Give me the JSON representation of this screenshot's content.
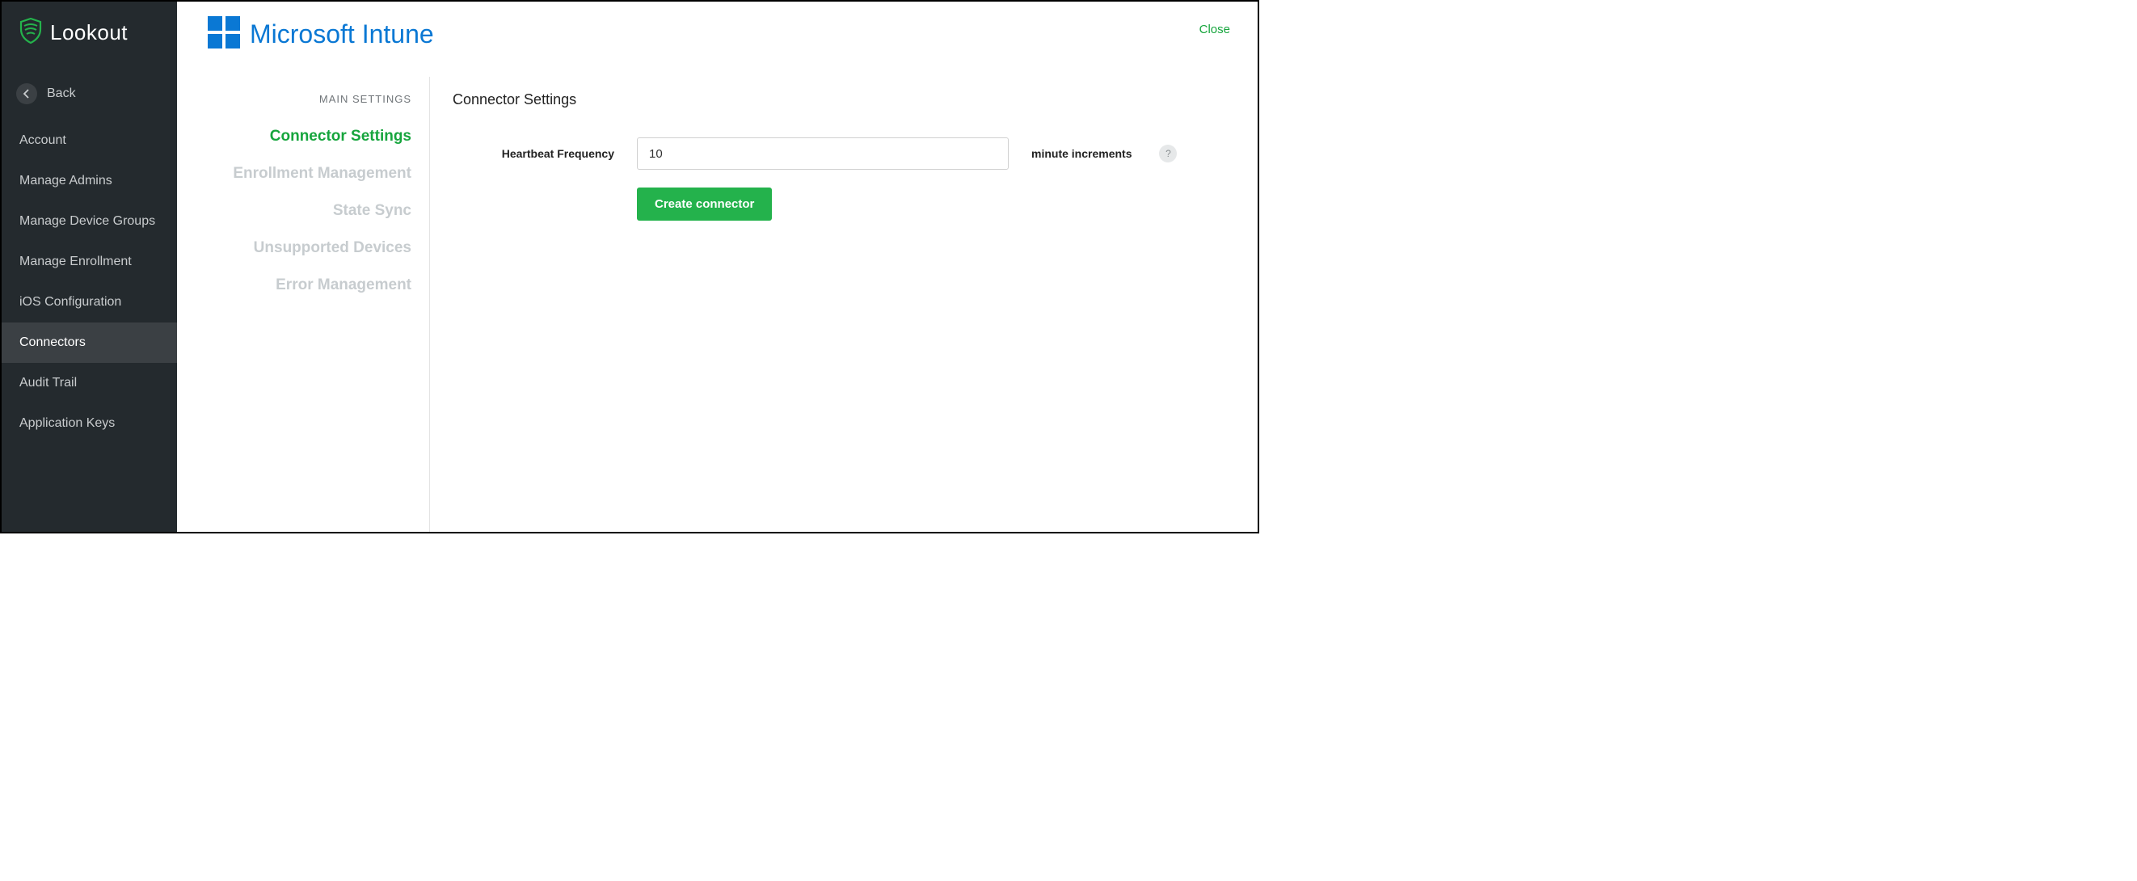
{
  "brand": {
    "name": "Lookout"
  },
  "sidebar": {
    "back_label": "Back",
    "items": [
      {
        "label": "Account",
        "active": false
      },
      {
        "label": "Manage Admins",
        "active": false
      },
      {
        "label": "Manage Device Groups",
        "active": false
      },
      {
        "label": "Manage Enrollment",
        "active": false
      },
      {
        "label": "iOS Configuration",
        "active": false
      },
      {
        "label": "Connectors",
        "active": true
      },
      {
        "label": "Audit Trail",
        "active": false
      },
      {
        "label": "Application Keys",
        "active": false
      }
    ]
  },
  "header": {
    "connector_name": "Microsoft Intune",
    "close_label": "Close"
  },
  "settings_nav": {
    "title": "MAIN SETTINGS",
    "items": [
      {
        "label": "Connector Settings",
        "active": true
      },
      {
        "label": "Enrollment Management",
        "active": false
      },
      {
        "label": "State Sync",
        "active": false
      },
      {
        "label": "Unsupported Devices",
        "active": false
      },
      {
        "label": "Error Management",
        "active": false
      }
    ]
  },
  "detail": {
    "title": "Connector Settings",
    "heartbeat_label": "Heartbeat Frequency",
    "heartbeat_value": "10",
    "heartbeat_suffix": "minute increments",
    "help_symbol": "?",
    "create_button": "Create connector"
  }
}
